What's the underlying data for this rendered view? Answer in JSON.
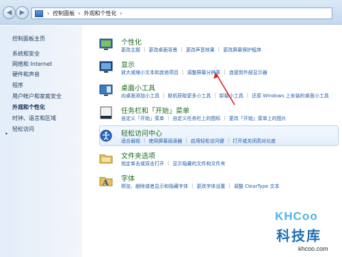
{
  "address": {
    "breadcrumbs": [
      "控制面板",
      "外观和个性化"
    ]
  },
  "left_pane": {
    "home": "控制面板主页",
    "items": [
      "系统和安全",
      "网络和 Internet",
      "硬件和声音",
      "程序",
      "用户帐户和家庭安全",
      "外观和个性化",
      "时钟、语言和区域",
      "轻松访问"
    ],
    "active_index": 5
  },
  "categories": [
    {
      "title": "个性化",
      "links": [
        "更改主题",
        "更改桌面背景",
        "更改声音效果",
        "更改屏幕保护程序"
      ],
      "icon": "personalization-icon"
    },
    {
      "title": "显示",
      "links": [
        "放大或缩小文本和其他项目",
        "调整屏幕分辨率",
        "连接到外部显示器"
      ],
      "icon": "display-icon"
    },
    {
      "title": "桌面小工具",
      "links": [
        "向桌面添加小工具",
        "联机获取更多小工具",
        "卸载小工具",
        "还原 Windows 上安装的桌面小工具"
      ],
      "icon": "gadgets-icon"
    },
    {
      "title": "任务栏和「开始」菜单",
      "links": [
        "自定义「开始」菜单",
        "自定义任务栏上的图标",
        "更改「开始」菜单上的图片"
      ],
      "icon": "taskbar-icon"
    },
    {
      "title": "轻松访问中心",
      "links": [
        "适合弱视",
        "使用屏幕阅读器",
        "启用轻松访问键",
        "打开或关闭高对比度"
      ],
      "icon": "ease-of-access-icon"
    },
    {
      "title": "文件夹选项",
      "links": [
        "指定单击或双击打开",
        "显示隐藏的文件和文件夹"
      ],
      "icon": "folder-icon"
    },
    {
      "title": "字体",
      "links": [
        "预览、删除或者显示和隐藏字体",
        "更改字体设置",
        "调整 ClearType 文本"
      ],
      "icon": "fonts-icon"
    }
  ],
  "watermark": {
    "logo": "KHCoo",
    "name": "科技库",
    "url": "khcoo.com"
  }
}
